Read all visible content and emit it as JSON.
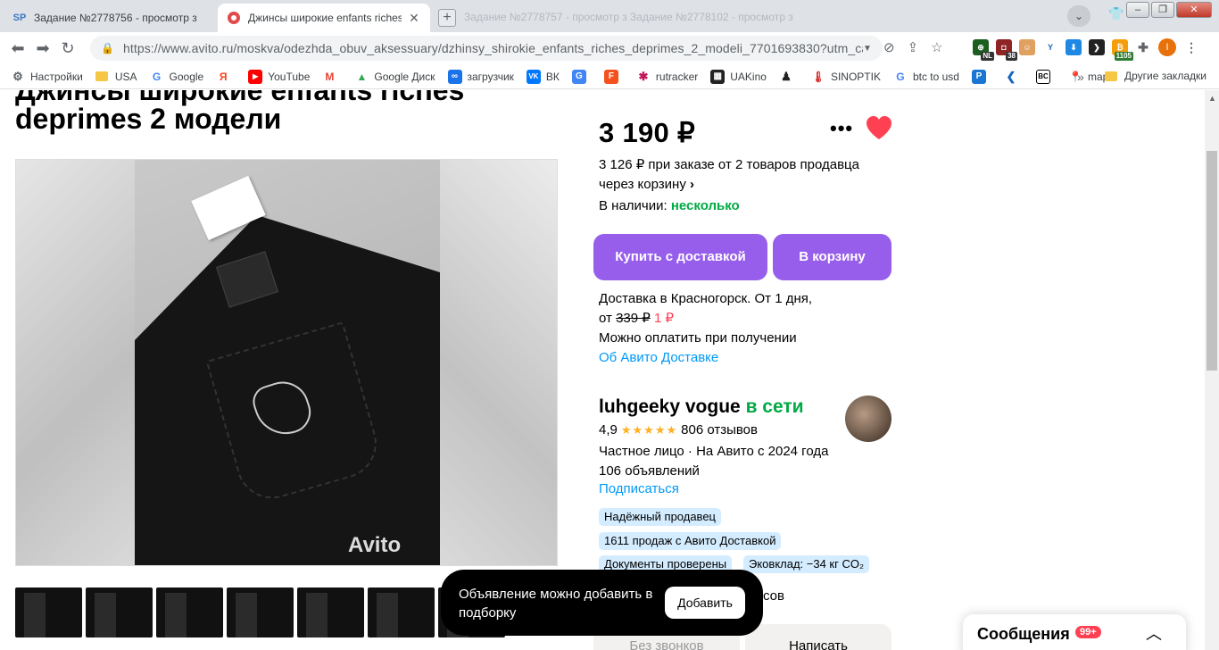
{
  "browser": {
    "tabs": [
      {
        "favicon": "SP",
        "title": "Задание №2778756 - просмотр з",
        "active": false
      },
      {
        "favicon": "avito-icon",
        "title": "Джинсы широкие enfants riches c",
        "active": true
      }
    ],
    "ghost_tabs": "Задание №2778757 - просмотр з    Задание №2778102 - просмотр з",
    "url": "https://www.avito.ru/moskva/odezhda_obuv_aksessuary/dzhinsy_shirokie_enfants_riches_deprimes_2_modeli_7701693830?utm_camp...",
    "bookmarks": [
      {
        "label": "Настройки",
        "icon": "gear-icon"
      },
      {
        "label": "USA",
        "icon": "folder-icon"
      },
      {
        "label": "Google",
        "icon": "google-icon"
      },
      {
        "label": "",
        "icon": "yandex-icon"
      },
      {
        "label": "YouTube",
        "icon": "youtube-icon"
      },
      {
        "label": "",
        "icon": "gmail-icon"
      },
      {
        "label": "Google Диск",
        "icon": "drive-icon"
      },
      {
        "label": "загрузчик",
        "icon": "infinity-icon"
      },
      {
        "label": "ВК",
        "icon": "vk-icon"
      },
      {
        "label": "",
        "icon": "translate-icon"
      },
      {
        "label": "",
        "icon": "f-icon"
      },
      {
        "label": "rutracker",
        "icon": "rutracker-icon"
      },
      {
        "label": "UAKino",
        "icon": "uakino-icon"
      },
      {
        "label": "",
        "icon": "pawn-icon"
      },
      {
        "label": "SINOPTIK",
        "icon": "thermometer-icon"
      },
      {
        "label": "btc to usd",
        "icon": "google-icon"
      },
      {
        "label": "",
        "icon": "p-icon"
      },
      {
        "label": "",
        "icon": "arrow-icon"
      },
      {
        "label": "",
        "icon": "bc-icon"
      },
      {
        "label": "maps",
        "icon": "maps-icon"
      }
    ],
    "bookmarks_more": "»",
    "other_bookmarks": "Другие закладки",
    "extension_badges": {
      "nl": "NL",
      "count38": "38",
      "count1105": "1105"
    },
    "profile_letter": "I"
  },
  "listing": {
    "title_line1": "Джинсы широкие enfants riches",
    "title_line2": "deprimes 2 модели",
    "price": "3 190 ₽",
    "more": "•••",
    "cart_price_line1": "3 126 ₽ при заказе от 2 товаров продавца",
    "cart_price_line2": "через корзину",
    "stock_label": "В наличии:",
    "stock_value": "несколько",
    "buy_button": "Купить с доставкой",
    "cart_button": "В корзину",
    "delivery_line1": "Доставка в Красногорск. От 1 дня,",
    "delivery_from": "от",
    "delivery_old_price": "339 ₽",
    "delivery_new_price": "1 ₽",
    "delivery_line3": "Можно оплатить при получении",
    "delivery_link": "Об Авито Доставке",
    "watermark": "Avito",
    "thumb_count": 7
  },
  "seller": {
    "name": "luhgeeky vogue",
    "status": "в сети",
    "rating": "4,9",
    "stars": "★★★★★",
    "reviews": "806 отзывов",
    "meta_line1": "Частное лицо · На Авито с 2024 года",
    "meta_line2": "106 объявлений",
    "subscribe": "Подписаться",
    "badges": [
      "Надёжный продавец",
      "1611 продаж с Авито Доставкой",
      "Документы проверены",
      "Эковклад: −34 кг CO₂"
    ],
    "hours_fragment": "сов",
    "no_calls_button": "Без звонков",
    "write_button": "Написать"
  },
  "toast": {
    "message": "Объявление можно добавить в подборку",
    "action": "Добавить"
  },
  "messages_widget": {
    "title": "Сообщения",
    "count": "99+"
  },
  "colors": {
    "accent": "#965eeb",
    "online": "#00aa44",
    "link": "#0099f7",
    "heart": "#ff4053"
  }
}
